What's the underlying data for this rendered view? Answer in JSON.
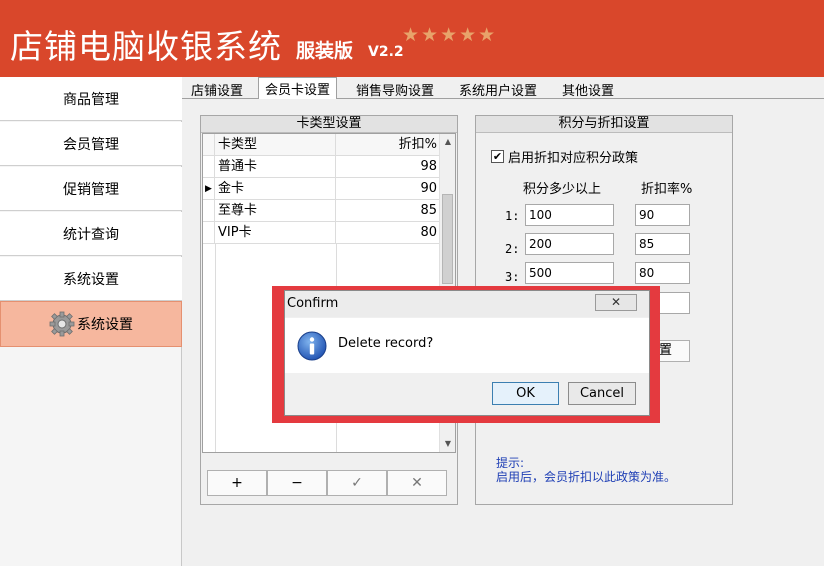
{
  "header": {
    "title": "店铺电脑收银系统",
    "edition": "服装版",
    "version": "V2.2",
    "stars": "★★★★★"
  },
  "sidebar": {
    "items": [
      {
        "label": "商品管理"
      },
      {
        "label": "会员管理"
      },
      {
        "label": "促销管理"
      },
      {
        "label": "统计查询"
      },
      {
        "label": "系统设置"
      },
      {
        "label": "系统设置",
        "active": true,
        "icon": "gear-icon"
      }
    ]
  },
  "tabs": [
    {
      "label": "店铺设置"
    },
    {
      "label": "会员卡设置",
      "active": true
    },
    {
      "label": "销售导购设置"
    },
    {
      "label": "系统用户设置"
    },
    {
      "label": "其他设置"
    }
  ],
  "card_panel": {
    "title": "卡类型设置",
    "columns": {
      "type": "卡类型",
      "discount": "折扣%"
    },
    "rows": [
      {
        "type": "普通卡",
        "discount": "98"
      },
      {
        "type": "金卡",
        "discount": "90",
        "current": true
      },
      {
        "type": "至尊卡",
        "discount": "85"
      },
      {
        "type": "VIP卡",
        "discount": "80"
      }
    ],
    "buttons": {
      "add": "+",
      "remove": "−",
      "confirm": "✓",
      "cancel": "✕"
    }
  },
  "points_panel": {
    "title": "积分与折扣设置",
    "checkbox_label": "启用折扣对应积分政策",
    "checked": true,
    "col_points": "积分多少以上",
    "col_rate": "折扣率%",
    "rows": [
      {
        "num": "1:",
        "points": "100",
        "rate": "90"
      },
      {
        "num": "2:",
        "points": "200",
        "rate": "85"
      },
      {
        "num": "3:",
        "points": "500",
        "rate": "80"
      }
    ],
    "partial_button": "置",
    "hint_title": "提示:",
    "hint_text": "启用后，会员折扣以此政策为准。"
  },
  "dialog": {
    "title": "Confirm",
    "close": "✕",
    "message": "Delete record?",
    "ok": "OK",
    "cancel": "Cancel",
    "icon": "info-icon"
  },
  "colors": {
    "header": "#d9472b",
    "active_sidebar": "#f6b79e",
    "dialog_highlight": "#e43a3f",
    "hint_text": "#1f3fb5"
  }
}
